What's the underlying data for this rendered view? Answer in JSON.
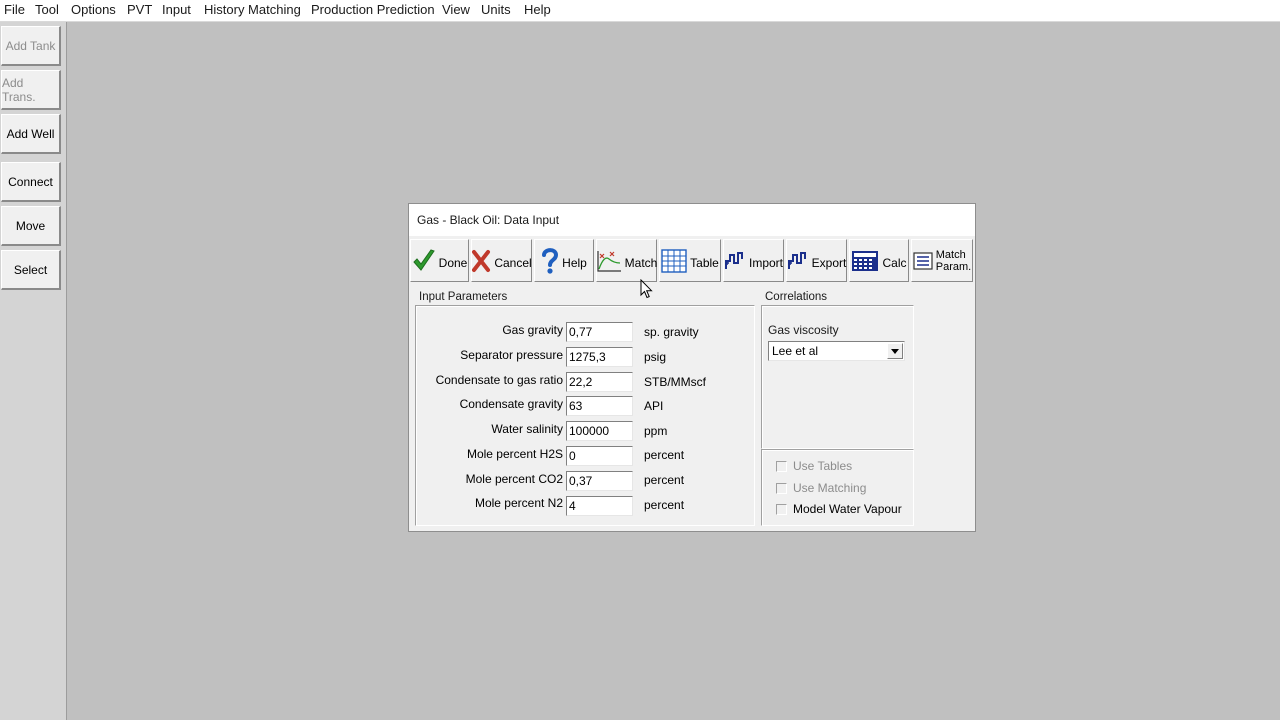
{
  "menubar": {
    "items": [
      "File",
      "Tool",
      "Options",
      "PVT",
      "Input",
      "History Matching",
      "Production Prediction",
      "View",
      "Units",
      "Help"
    ]
  },
  "toolbar": {
    "buttons": [
      {
        "label": "Add Tank",
        "enabled": false
      },
      {
        "label": "Add Trans.",
        "enabled": false
      },
      {
        "label": "Add Well",
        "enabled": true
      },
      {
        "label": "Connect",
        "enabled": true
      },
      {
        "label": "Move",
        "enabled": true
      },
      {
        "label": "Select",
        "enabled": true
      }
    ]
  },
  "dialog": {
    "title": "Gas - Black Oil: Data Input",
    "buttons": {
      "done": "Done",
      "cancel": "Cancel",
      "help": "Help",
      "match": "Match",
      "table": "Table",
      "import": "Import",
      "export": "Export",
      "calc": "Calc",
      "match_param_line1": "Match",
      "match_param_line2": "Param."
    },
    "input_parameters": {
      "title": "Input Parameters",
      "rows": [
        {
          "label": "Gas gravity",
          "value": "0,77",
          "unit": "sp. gravity"
        },
        {
          "label": "Separator pressure",
          "value": "1275,3",
          "unit": "psig"
        },
        {
          "label": "Condensate to gas ratio",
          "value": "22,2",
          "unit": "STB/MMscf"
        },
        {
          "label": "Condensate gravity",
          "value": "63",
          "unit": "API"
        },
        {
          "label": "Water salinity",
          "value": "100000",
          "unit": "ppm"
        },
        {
          "label": "Mole percent H2S",
          "value": "0",
          "unit": "percent"
        },
        {
          "label": "Mole percent CO2",
          "value": "0,37",
          "unit": "percent"
        },
        {
          "label": "Mole percent N2",
          "value": "4",
          "unit": "percent"
        }
      ]
    },
    "correlations": {
      "title": "Correlations",
      "gas_viscosity_label": "Gas viscosity",
      "gas_viscosity_value": "Lee et al"
    },
    "options": [
      {
        "label": "Use Tables",
        "checked": false,
        "enabled": false
      },
      {
        "label": "Use Matching",
        "checked": false,
        "enabled": false
      },
      {
        "label": "Model Water Vapour",
        "checked": false,
        "enabled": true
      }
    ]
  },
  "colors": {
    "desktop": "#c0c0c0",
    "dialog_face": "#f0f0f0",
    "done_check": "#2e9a2e",
    "cancel_x": "#c0392b",
    "help_icon": "#1f5fbf",
    "calc_icon": "#1b2f8c",
    "disabled_text": "#8c8c8c"
  }
}
